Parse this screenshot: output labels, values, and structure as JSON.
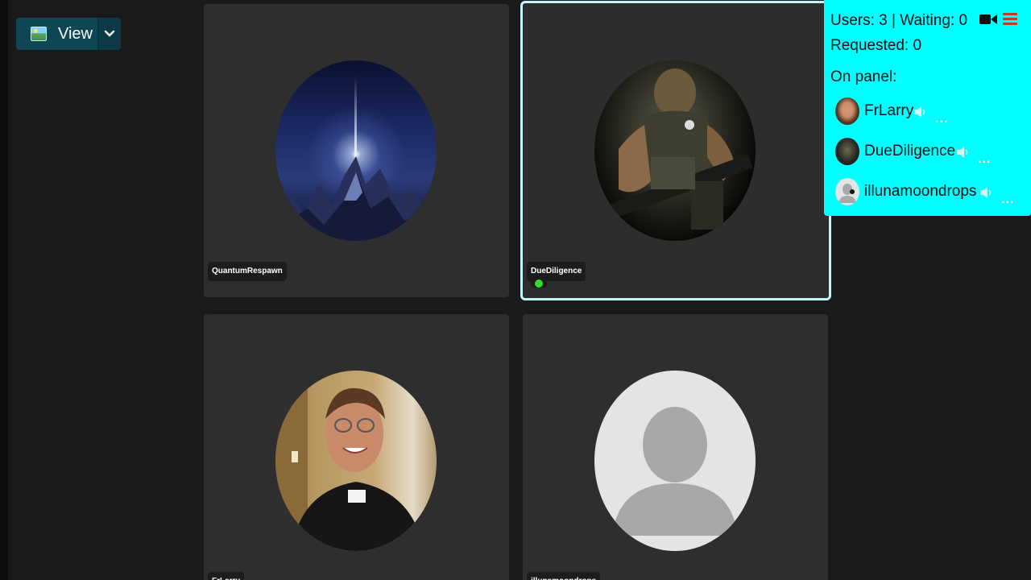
{
  "toolbar": {
    "view_label": "View",
    "view_icon": "image-icon",
    "dropdown_icon": "chevron-down-icon"
  },
  "tiles": [
    {
      "name": "QuantumRespawn",
      "avatar": "space-mountain-avatar",
      "active": false,
      "speaking": false
    },
    {
      "name": "DueDiligence",
      "avatar": "soldier-avatar",
      "active": true,
      "speaking": true
    },
    {
      "name": "FrLarry",
      "avatar": "priest-photo-avatar",
      "active": false,
      "speaking": false
    },
    {
      "name": "illunamoondrops",
      "avatar": "default-user-avatar",
      "active": false,
      "speaking": false
    }
  ],
  "panel": {
    "users_line": "Users: 3 | Waiting: 0",
    "requested_line": "Requested: 0",
    "on_panel_label": "On panel:",
    "icons": {
      "camera": "video-camera-icon",
      "menu": "hamburger-menu-icon"
    },
    "users": [
      {
        "name": "FrLarry",
        "more": "..."
      },
      {
        "name": "DueDiligence",
        "more": "..."
      },
      {
        "name": "illunamoondrops",
        "more": "..."
      }
    ]
  },
  "colors": {
    "background": "#1a1a1a",
    "tile": "#2e2e2e",
    "panel": "#00ffff",
    "active_border": "#bff7ff",
    "speaking": "#2fdc2f",
    "menu_icon": "#c0392b",
    "view_button": "#0f4654"
  }
}
